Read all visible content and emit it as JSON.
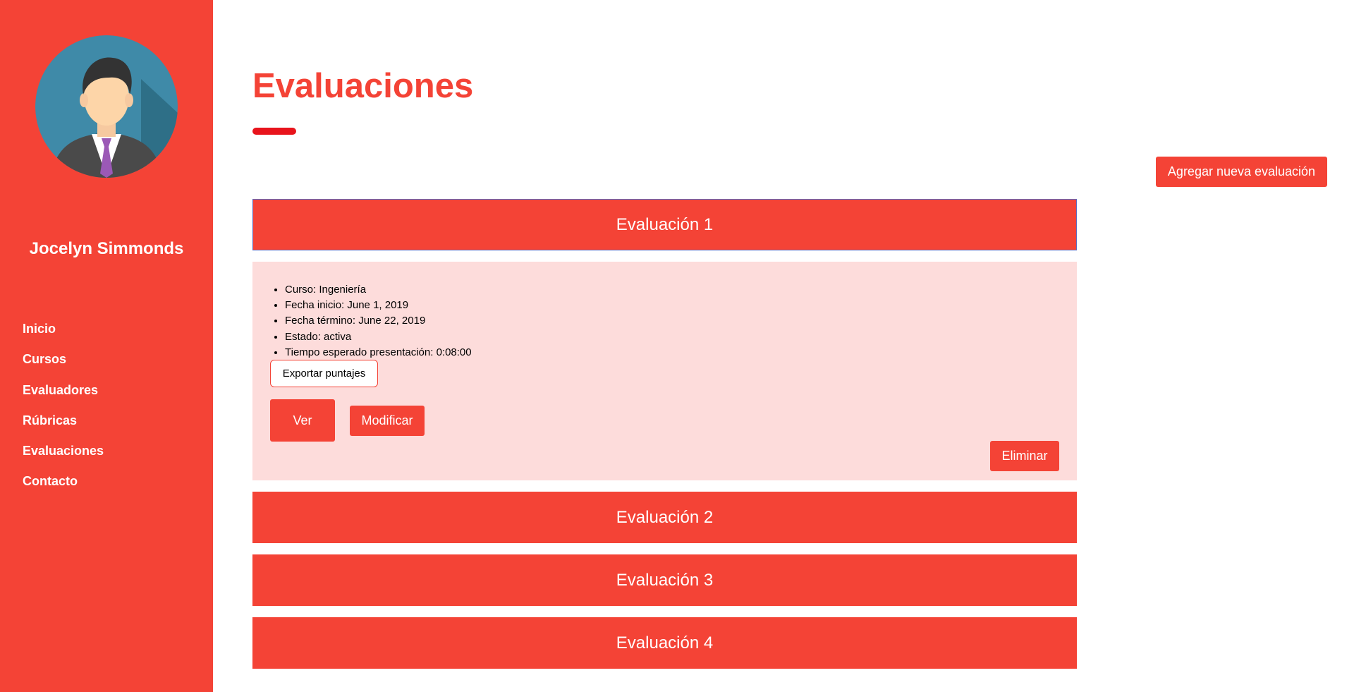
{
  "sidebar": {
    "user_name": "Jocelyn Simmonds",
    "nav": [
      "Inicio",
      "Cursos",
      "Evaluadores",
      "Rúbricas",
      "Evaluaciones",
      "Contacto"
    ]
  },
  "main": {
    "title": "Evaluaciones",
    "add_button": "Agregar nueva evaluación",
    "evaluations": [
      {
        "title": "Evaluación 1",
        "details": [
          "Curso: Ingeniería",
          "Fecha inicio: June 1, 2019",
          "Fecha término: June 22, 2019",
          "Estado: activa",
          "Tiempo esperado presentación: 0:08:00"
        ],
        "export_button": "Exportar puntajes",
        "view_button": "Ver",
        "modify_button": "Modificar",
        "delete_button": "Eliminar"
      },
      {
        "title": "Evaluación 2"
      },
      {
        "title": "Evaluación 3"
      },
      {
        "title": "Evaluación 4"
      }
    ]
  },
  "colors": {
    "primary": "#f44336",
    "panel_background": "#fddcdb",
    "underline": "#e8141c"
  }
}
